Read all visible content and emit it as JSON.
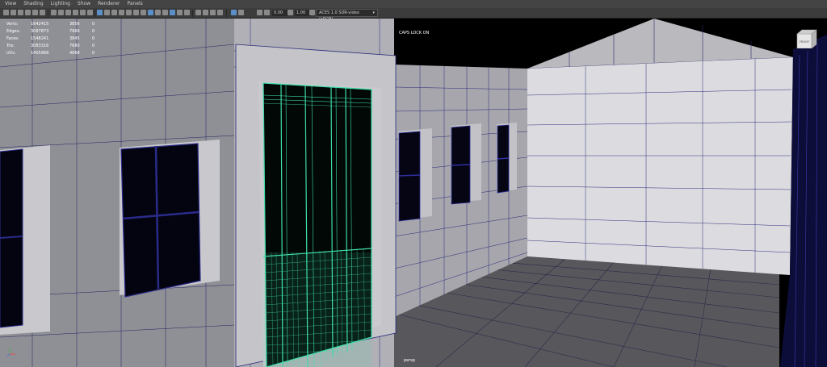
{
  "menu": [
    "View",
    "Shading",
    "Lighting",
    "Show",
    "Renderer",
    "Panels"
  ],
  "toolbar": {
    "field_a": "0.00",
    "field_b": "1.00",
    "color_space": "ACES 1.0 SDR-video (sRGB)"
  },
  "hud": {
    "stats": [
      {
        "label": "Verts:",
        "v1": "1642415",
        "v2": "3856",
        "v3": "0"
      },
      {
        "label": "Edges:",
        "v1": "3087873",
        "v2": "7666",
        "v3": "0"
      },
      {
        "label": "Faces:",
        "v1": "1548241",
        "v2": "3845",
        "v3": "0"
      },
      {
        "label": "Tris:",
        "v1": "3083316",
        "v2": "7680",
        "v3": "0"
      },
      {
        "label": "UVs:",
        "v1": "1405968",
        "v2": "4668",
        "v3": "0"
      }
    ],
    "caps_lock": "CAPS LOCK ON",
    "camera": "persp",
    "viewcube_label": "FRONT"
  },
  "colors": {
    "wall": "#b5b5bb",
    "wall_dark": "#8f8f96",
    "floor": "#5a5a5e",
    "wire": "#1d1d7a",
    "selection": "#3fdca8",
    "menubar": "#444444",
    "toolbar": "#3c3c3c",
    "background": "#000000"
  }
}
